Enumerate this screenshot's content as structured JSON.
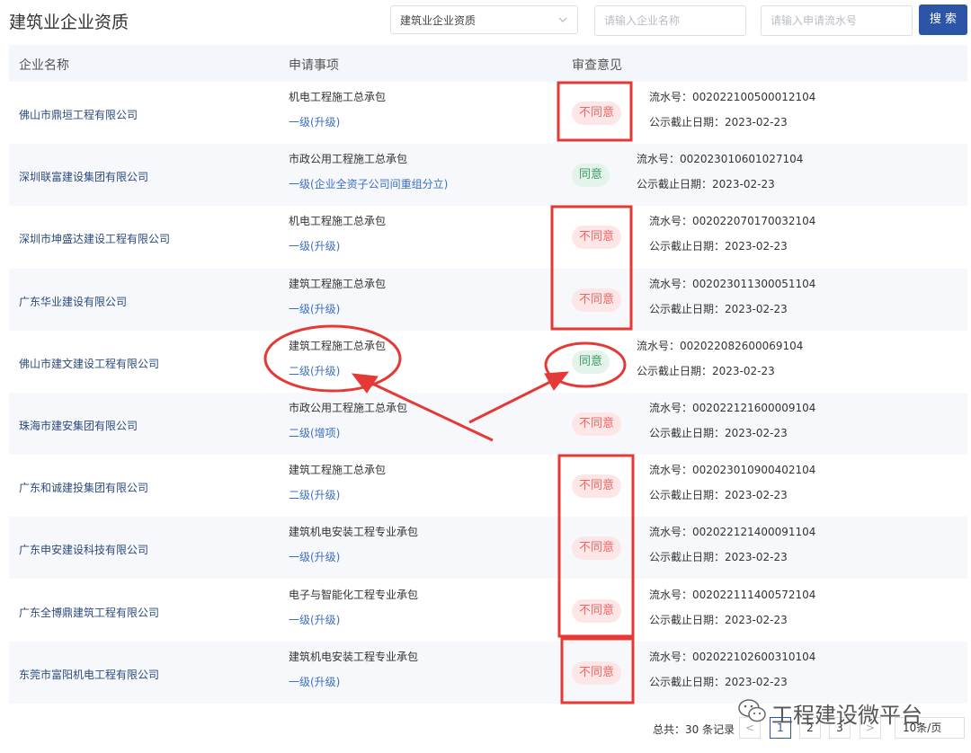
{
  "page": {
    "title": "建筑业企业资质"
  },
  "filters": {
    "category_value": "建筑业企业资质",
    "company_placeholder": "请输入企业名称",
    "serial_placeholder": "请输入申请流水号",
    "search_label": "搜 索"
  },
  "table": {
    "headers": [
      "企业名称",
      "申请事项",
      "审查意见"
    ],
    "rows": [
      {
        "company": "佛山市鼎垣工程有限公司",
        "item": "机电工程施工总承包",
        "level": "一级(升级)",
        "opinion": "不同意",
        "serial": "流水号：002022100500012104",
        "deadline": "公示截止日期：2023-02-23"
      },
      {
        "company": "深圳联富建设集团有限公司",
        "item": "市政公用工程施工总承包",
        "level": "一级(企业全资子公司间重组分立)",
        "opinion": "同意",
        "serial": "流水号：002023010601027104",
        "deadline": "公示截止日期：2023-02-23"
      },
      {
        "company": "深圳市坤盛达建设工程有限公司",
        "item": "机电工程施工总承包",
        "level": "一级(升级)",
        "opinion": "不同意",
        "serial": "流水号：002022070170032104",
        "deadline": "公示截止日期：2023-02-23"
      },
      {
        "company": "广东华业建设有限公司",
        "item": "建筑工程施工总承包",
        "level": "一级(升级)",
        "opinion": "不同意",
        "serial": "流水号：002023011300051104",
        "deadline": "公示截止日期：2023-02-23"
      },
      {
        "company": "佛山市建文建设工程有限公司",
        "item": "建筑工程施工总承包",
        "level": "二级(升级)",
        "opinion": "同意",
        "serial": "流水号：002022082600069104",
        "deadline": "公示截止日期：2023-02-23"
      },
      {
        "company": "珠海市建安集团有限公司",
        "item": "市政公用工程施工总承包",
        "level": "二级(增项)",
        "opinion": "不同意",
        "serial": "流水号：002022121600009104",
        "deadline": "公示截止日期：2023-02-23"
      },
      {
        "company": "广东和诚建投集团有限公司",
        "item": "建筑工程施工总承包",
        "level": "二级(升级)",
        "opinion": "不同意",
        "serial": "流水号：002023010900402104",
        "deadline": "公示截止日期：2023-02-23"
      },
      {
        "company": "广东申安建设科技有限公司",
        "item": "建筑机电安装工程专业承包",
        "level": "一级(升级)",
        "opinion": "不同意",
        "serial": "流水号：002022121400091104",
        "deadline": "公示截止日期：2023-02-23"
      },
      {
        "company": "广东全博鼎建筑工程有限公司",
        "item": "电子与智能化工程专业承包",
        "level": "一级(升级)",
        "opinion": "不同意",
        "serial": "流水号：002022111400572104",
        "deadline": "公示截止日期：2023-02-23"
      },
      {
        "company": "东莞市富阳机电工程有限公司",
        "item": "建筑机电安装工程专业承包",
        "level": "一级(升级)",
        "opinion": "不同意",
        "serial": "流水号：002022102600310104",
        "deadline": "公示截止日期：2023-02-23"
      }
    ]
  },
  "pagination": {
    "total": "总共：30 条记录",
    "prev": "<",
    "pages": [
      "1",
      "2",
      "3"
    ],
    "next": ">",
    "page_size": "10条/页"
  },
  "watermark": {
    "text": "工程建设微平台"
  },
  "colors": {
    "primary": "#2c55a8",
    "reject_bg": "#fde6e6",
    "reject_text": "#ef6666",
    "approve_bg": "#e4f4ea",
    "approve_text": "#3c9a64",
    "annotation_red": "#e53935"
  }
}
